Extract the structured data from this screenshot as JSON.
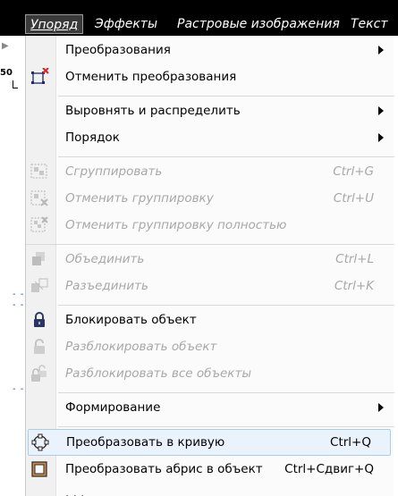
{
  "menubar": {
    "items": [
      {
        "label": "Упоряд",
        "active": true
      },
      {
        "label": "Эффекты"
      },
      {
        "label": "Растровые изображения"
      },
      {
        "label": "Текст"
      }
    ]
  },
  "docstrip": {
    "ruler_label": "50"
  },
  "menu": {
    "items": [
      {
        "label": "Преобразования",
        "submenu": true,
        "icon": "none"
      },
      {
        "label": "Отменить преобразования",
        "icon": "clear-transform-icon"
      },
      {
        "label": "Выровнять и распределить",
        "submenu": true,
        "icon": "none"
      },
      {
        "label": "Порядок",
        "submenu": true,
        "icon": "none"
      },
      {
        "label": "Сгруппировать",
        "shortcut": "Ctrl+G",
        "disabled": true,
        "icon": "group-icon"
      },
      {
        "label": "Отменить группировку",
        "shortcut": "Ctrl+U",
        "disabled": true,
        "icon": "ungroup-icon"
      },
      {
        "label": "Отменить группировку полностью",
        "disabled": true,
        "icon": "ungroup-all-icon"
      },
      {
        "label": "Объединить",
        "shortcut": "Ctrl+L",
        "disabled": true,
        "icon": "combine-icon"
      },
      {
        "label": "Разъединить",
        "shortcut": "Ctrl+K",
        "disabled": true,
        "icon": "break-apart-icon"
      },
      {
        "label": "Блокировать объект",
        "icon": "lock-icon"
      },
      {
        "label": "Разблокировать объект",
        "disabled": true,
        "icon": "unlock-icon"
      },
      {
        "label": "Разблокировать все объекты",
        "disabled": true,
        "icon": "unlock-all-icon"
      },
      {
        "label": "Формирование",
        "submenu": true,
        "icon": "none"
      },
      {
        "label": "Преобразовать в кривую",
        "shortcut": "Ctrl+Q",
        "highlighted": true,
        "icon": "convert-to-curves-icon"
      },
      {
        "label": "Преобразовать абрис в объект",
        "shortcut": "Ctrl+Сдвиг+Q",
        "icon": "outline-to-object-icon"
      }
    ]
  },
  "colors": {
    "menubar_bg": "#000000",
    "disabled_text": "#a8a8a8",
    "highlight_bg": "#eaf3fc",
    "highlight_border": "#a8cdee"
  }
}
